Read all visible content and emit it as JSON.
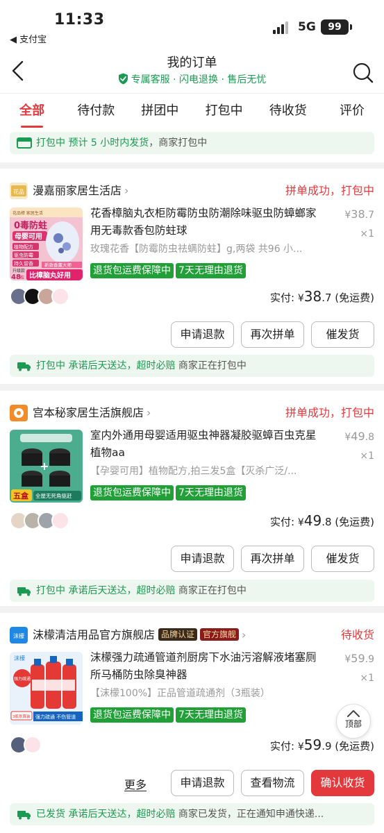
{
  "status_bar": {
    "time": "11:33",
    "back_app": "◀ 支付宝",
    "network": "5G",
    "battery": "99"
  },
  "header": {
    "title": "我的订单",
    "subtitle": "专属客服 · 闪电退换 · 售后无忧"
  },
  "tabs": [
    {
      "label": "全部",
      "active": true
    },
    {
      "label": "待付款"
    },
    {
      "label": "拼团中"
    },
    {
      "label": "打包中"
    },
    {
      "label": "待收货"
    },
    {
      "label": "评价"
    }
  ],
  "top_partial": {
    "status": "打包中",
    "promise": "预计 5 小时内发货",
    "detail": "，商家打包中"
  },
  "orders": [
    {
      "store": "漫嘉丽家居生活店",
      "status": "拼单成功，打包中",
      "title": "花香樟脑丸衣柜防霉防虫防潮除味驱虫防蟑螂家用无毒款香包防蛀球",
      "spec": "玫瑰花香【防霉防虫祛螨防蛀】g,两袋 共96 小...",
      "price_int": "38",
      "price_dec": ".7",
      "qty": "×1",
      "badges": [
        "退货包运费保障中",
        "7天无理由退货"
      ],
      "paid_label": "实付:",
      "currency": "¥",
      "shipping": "(免运费)",
      "buttons": [
        "申请退款",
        "再次拼单",
        "催发货"
      ],
      "note_status": "打包中",
      "note_promise": "承诺后天送达，超时必赔",
      "note_detail": " 商家正在打包中",
      "thumb_text": {
        "brand": "花品樟 家居生活",
        "headline": "0毒防蛀",
        "sub": "母婴可用",
        "tags": [
          "植物配方",
          "驱虫防霉",
          "持久留香"
        ],
        "level": "升级款",
        "count": "48",
        "unit": "粒",
        "banner": "新款香薰大师",
        "bottom": "比樟脑丸好用"
      }
    },
    {
      "store": "宫本秘家居生活旗舰店",
      "status": "拼单成功，打包中",
      "title": "室内外通用母婴适用驱虫神器凝胶驱蟑百虫克星植物aa",
      "spec": "【孕婴可用】植物配方,拍三发5盒【灭杀广泛/...",
      "price_int": "49",
      "price_dec": ".8",
      "qty": "×1",
      "badges": [
        "退货包运费保障中",
        "7天无理由退货"
      ],
      "paid_label": "实付:",
      "currency": "¥",
      "shipping": "(免运费)",
      "buttons": [
        "申请退款",
        "再次拼单",
        "催发货"
      ],
      "note_status": "打包中",
      "note_promise": "承诺后天送达，超时必赔",
      "note_detail": " 商家正在打包中",
      "thumb_text": {
        "plus": "+",
        "promo": "五盒",
        "bottom": "全屋无死角驱赶"
      }
    },
    {
      "store": "沫檬清洁用品官方旗舰店",
      "tag_brand": "品牌认证",
      "tag_flag": "官方旗舰",
      "status": "待收货",
      "title": "沫檬强力疏通管道剂厨房下水油污溶解液堵塞厕所马桶防虫除臭神器",
      "spec": "【沫檬100%】正品管道疏通剂（3瓶装）",
      "price_int": "59",
      "price_dec": ".9",
      "qty": "×1",
      "badges": [
        "退货包运费保障中",
        "7天无理由退货"
      ],
      "paid_label": "实付:",
      "currency": "¥",
      "shipping": "(免运费)",
      "more_label": "更多",
      "buttons": [
        "申请退款",
        "查看物流",
        "确认收货"
      ],
      "note_status": "已发货",
      "note_promise": "承诺后天送达，超时必赔",
      "note_detail": " 商家已发货，正在通知申通快递...",
      "thumb_text": {
        "brand": "沫檬",
        "badge": "强力疏通",
        "left_tag": "3瓶划算装",
        "bottom": "强力疏通 不伤管道"
      }
    }
  ],
  "fab": {
    "label": "顶部"
  },
  "colors": {
    "accent": "#e4393c",
    "green": "#21a038",
    "note_bg": "#eef7ef",
    "green_text": "#1a9a52"
  }
}
